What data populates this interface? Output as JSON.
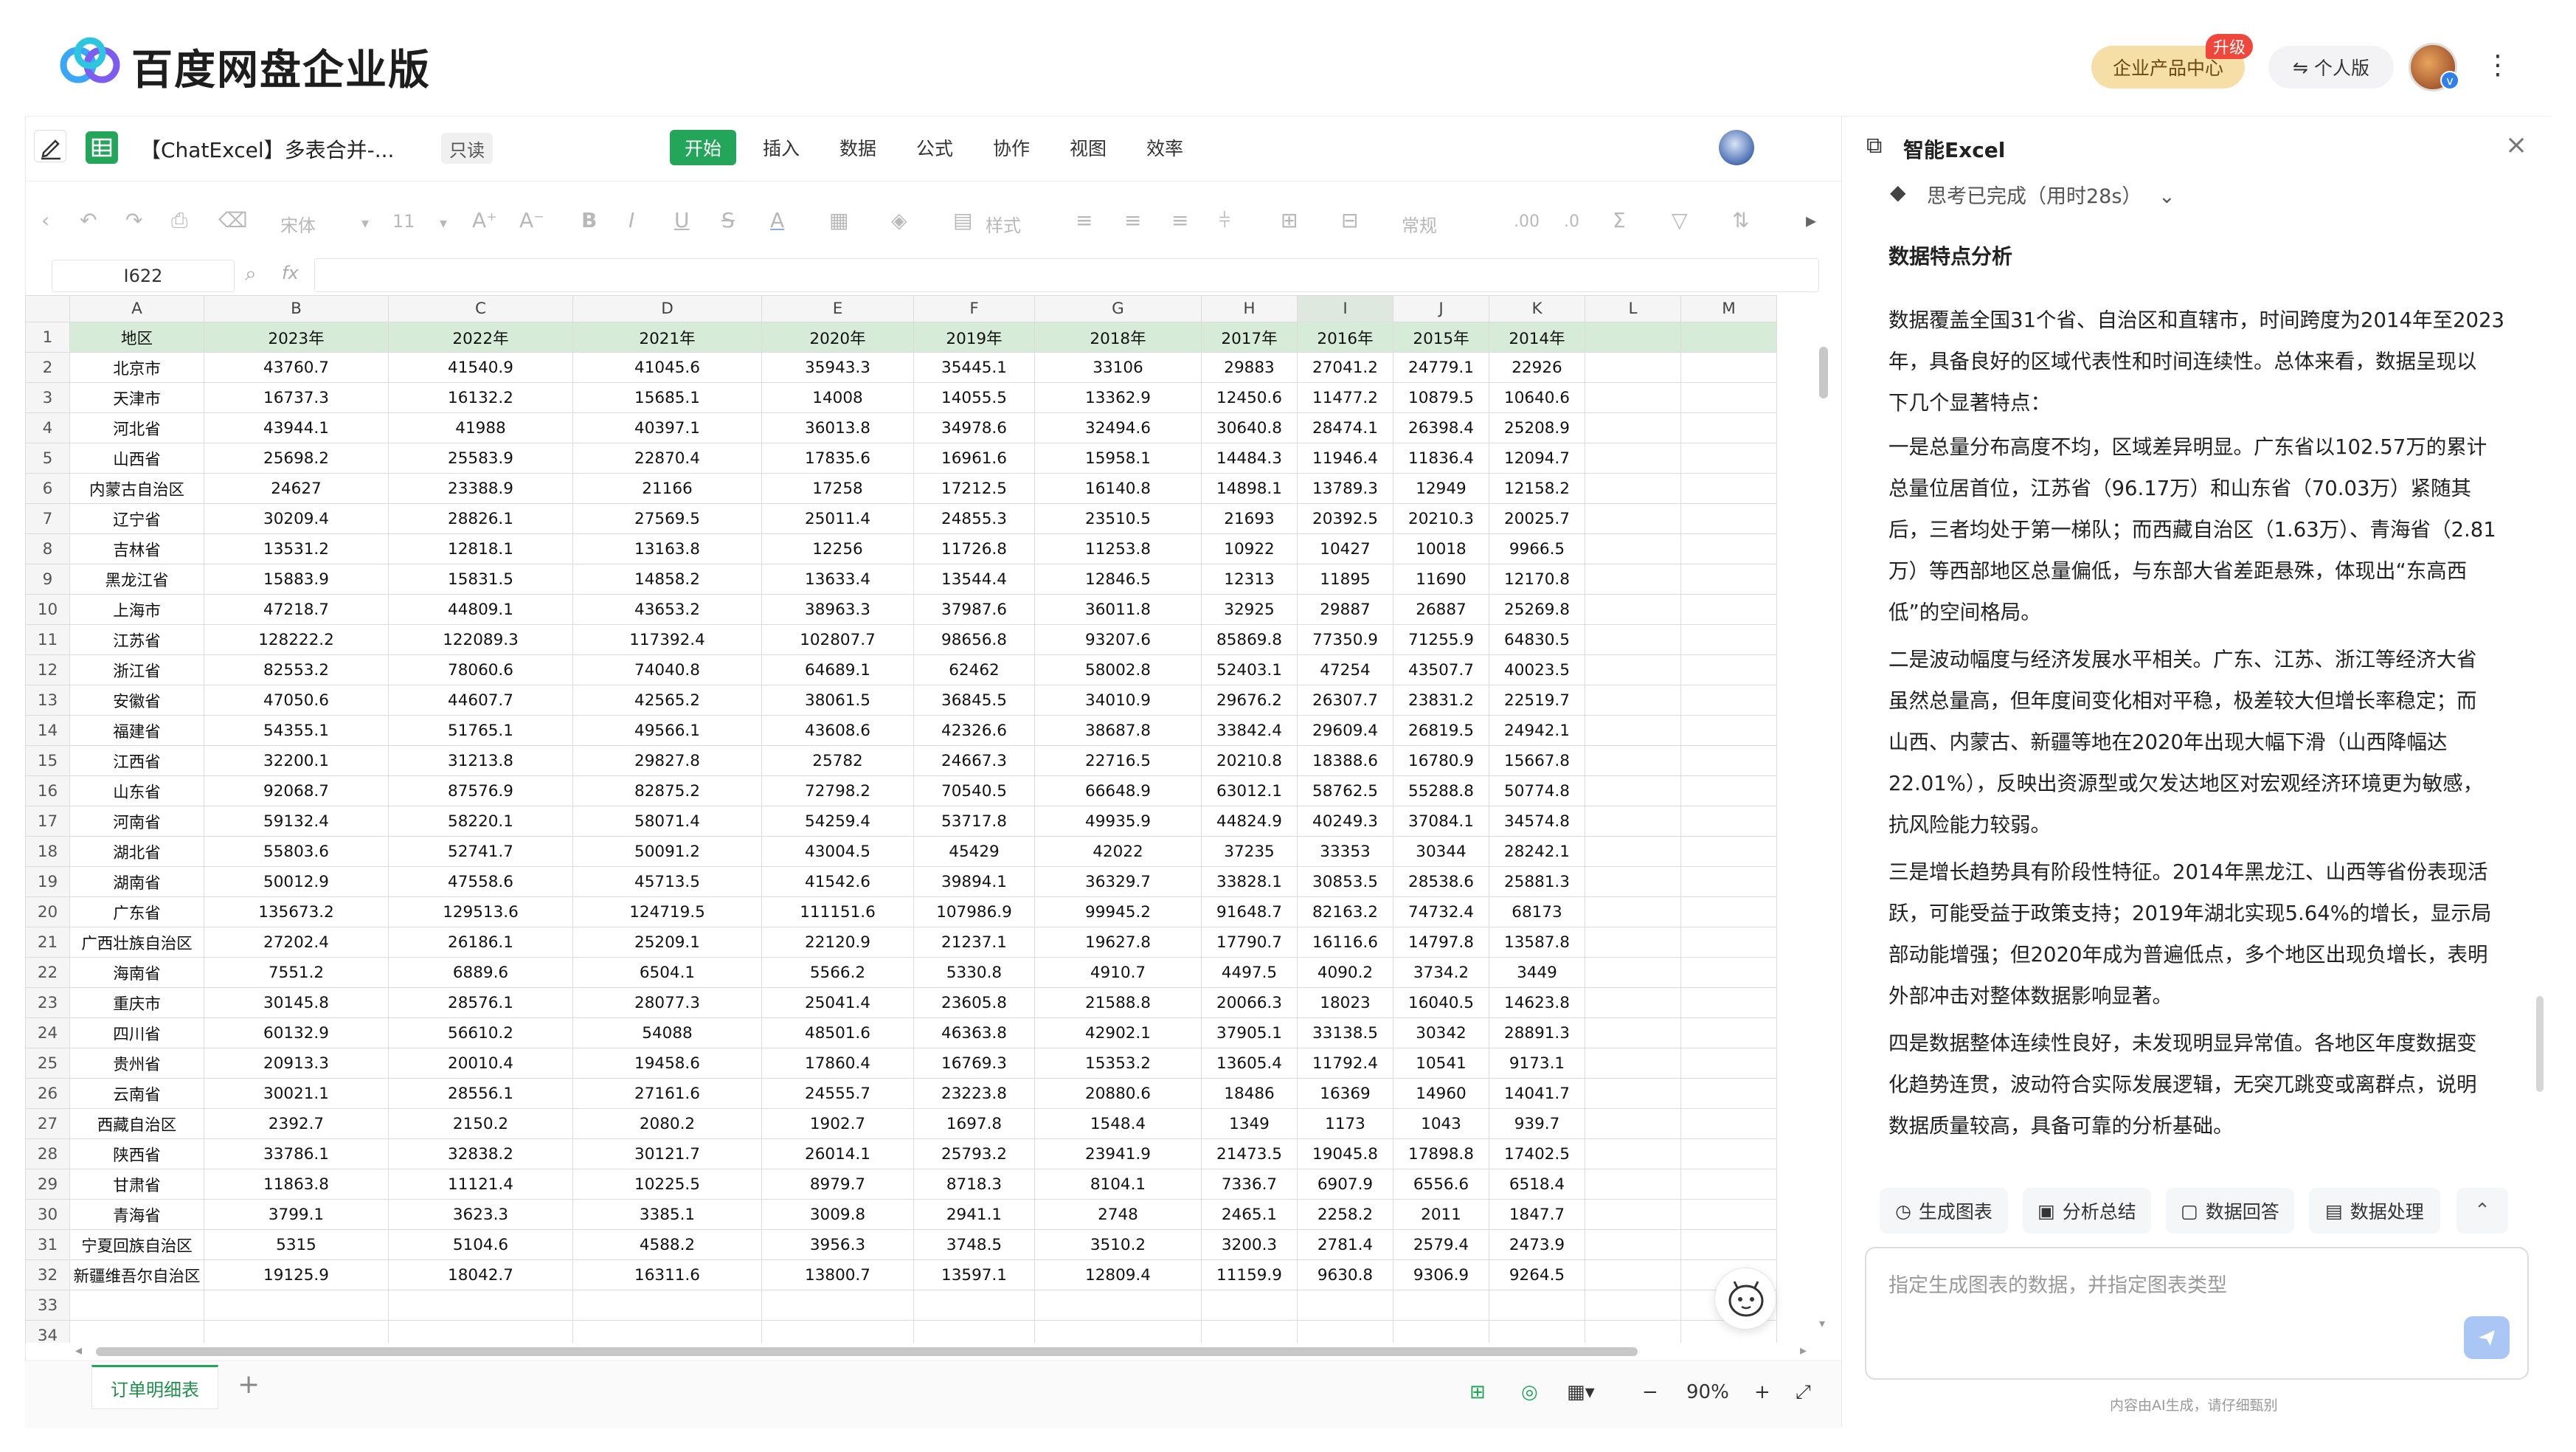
{
  "header": {
    "brand": "百度网盘企业版",
    "enterprise_center": "企业产品中心",
    "upgrade_badge": "升级",
    "personal": "个人版",
    "more": "⋮"
  },
  "doc": {
    "title": "【ChatExcel】多表合并-...",
    "readonly": "只读",
    "menus": [
      "开始",
      "插入",
      "数据",
      "公式",
      "协作",
      "视图",
      "效率"
    ]
  },
  "toolbar": {
    "font": "宋体",
    "size": "11",
    "style": "样式",
    "format": "常规"
  },
  "formula": {
    "cell_ref": "I622",
    "fx": "fx"
  },
  "sheet": {
    "col_letters": [
      "A",
      "B",
      "C",
      "D",
      "E",
      "F",
      "G",
      "H",
      "I",
      "J",
      "K",
      "L",
      "M"
    ],
    "headers": [
      "地区",
      "2023年",
      "2022年",
      "2021年",
      "2020年",
      "2019年",
      "2018年",
      "2017年",
      "2016年",
      "2015年",
      "2014年"
    ],
    "rows": [
      [
        "北京市",
        "43760.7",
        "41540.9",
        "41045.6",
        "35943.3",
        "35445.1",
        "33106",
        "29883",
        "27041.2",
        "24779.1",
        "22926"
      ],
      [
        "天津市",
        "16737.3",
        "16132.2",
        "15685.1",
        "14008",
        "14055.5",
        "13362.9",
        "12450.6",
        "11477.2",
        "10879.5",
        "10640.6"
      ],
      [
        "河北省",
        "43944.1",
        "41988",
        "40397.1",
        "36013.8",
        "34978.6",
        "32494.6",
        "30640.8",
        "28474.1",
        "26398.4",
        "25208.9"
      ],
      [
        "山西省",
        "25698.2",
        "25583.9",
        "22870.4",
        "17835.6",
        "16961.6",
        "15958.1",
        "14484.3",
        "11946.4",
        "11836.4",
        "12094.7"
      ],
      [
        "内蒙古自治区",
        "24627",
        "23388.9",
        "21166",
        "17258",
        "17212.5",
        "16140.8",
        "14898.1",
        "13789.3",
        "12949",
        "12158.2"
      ],
      [
        "辽宁省",
        "30209.4",
        "28826.1",
        "27569.5",
        "25011.4",
        "24855.3",
        "23510.5",
        "21693",
        "20392.5",
        "20210.3",
        "20025.7"
      ],
      [
        "吉林省",
        "13531.2",
        "12818.1",
        "13163.8",
        "12256",
        "11726.8",
        "11253.8",
        "10922",
        "10427",
        "10018",
        "9966.5"
      ],
      [
        "黑龙江省",
        "15883.9",
        "15831.5",
        "14858.2",
        "13633.4",
        "13544.4",
        "12846.5",
        "12313",
        "11895",
        "11690",
        "12170.8"
      ],
      [
        "上海市",
        "47218.7",
        "44809.1",
        "43653.2",
        "38963.3",
        "37987.6",
        "36011.8",
        "32925",
        "29887",
        "26887",
        "25269.8"
      ],
      [
        "江苏省",
        "128222.2",
        "122089.3",
        "117392.4",
        "102807.7",
        "98656.8",
        "93207.6",
        "85869.8",
        "77350.9",
        "71255.9",
        "64830.5"
      ],
      [
        "浙江省",
        "82553.2",
        "78060.6",
        "74040.8",
        "64689.1",
        "62462",
        "58002.8",
        "52403.1",
        "47254",
        "43507.7",
        "40023.5"
      ],
      [
        "安徽省",
        "47050.6",
        "44607.7",
        "42565.2",
        "38061.5",
        "36845.5",
        "34010.9",
        "29676.2",
        "26307.7",
        "23831.2",
        "22519.7"
      ],
      [
        "福建省",
        "54355.1",
        "51765.1",
        "49566.1",
        "43608.6",
        "42326.6",
        "38687.8",
        "33842.4",
        "29609.4",
        "26819.5",
        "24942.1"
      ],
      [
        "江西省",
        "32200.1",
        "31213.8",
        "29827.8",
        "25782",
        "24667.3",
        "22716.5",
        "20210.8",
        "18388.6",
        "16780.9",
        "15667.8"
      ],
      [
        "山东省",
        "92068.7",
        "87576.9",
        "82875.2",
        "72798.2",
        "70540.5",
        "66648.9",
        "63012.1",
        "58762.5",
        "55288.8",
        "50774.8"
      ],
      [
        "河南省",
        "59132.4",
        "58220.1",
        "58071.4",
        "54259.4",
        "53717.8",
        "49935.9",
        "44824.9",
        "40249.3",
        "37084.1",
        "34574.8"
      ],
      [
        "湖北省",
        "55803.6",
        "52741.7",
        "50091.2",
        "43004.5",
        "45429",
        "42022",
        "37235",
        "33353",
        "30344",
        "28242.1"
      ],
      [
        "湖南省",
        "50012.9",
        "47558.6",
        "45713.5",
        "41542.6",
        "39894.1",
        "36329.7",
        "33828.1",
        "30853.5",
        "28538.6",
        "25881.3"
      ],
      [
        "广东省",
        "135673.2",
        "129513.6",
        "124719.5",
        "111151.6",
        "107986.9",
        "99945.2",
        "91648.7",
        "82163.2",
        "74732.4",
        "68173"
      ],
      [
        "广西壮族自治区",
        "27202.4",
        "26186.1",
        "25209.1",
        "22120.9",
        "21237.1",
        "19627.8",
        "17790.7",
        "16116.6",
        "14797.8",
        "13587.8"
      ],
      [
        "海南省",
        "7551.2",
        "6889.6",
        "6504.1",
        "5566.2",
        "5330.8",
        "4910.7",
        "4497.5",
        "4090.2",
        "3734.2",
        "3449"
      ],
      [
        "重庆市",
        "30145.8",
        "28576.1",
        "28077.3",
        "25041.4",
        "23605.8",
        "21588.8",
        "20066.3",
        "18023",
        "16040.5",
        "14623.8"
      ],
      [
        "四川省",
        "60132.9",
        "56610.2",
        "54088",
        "48501.6",
        "46363.8",
        "42902.1",
        "37905.1",
        "33138.5",
        "30342",
        "28891.3"
      ],
      [
        "贵州省",
        "20913.3",
        "20010.4",
        "19458.6",
        "17860.4",
        "16769.3",
        "15353.2",
        "13605.4",
        "11792.4",
        "10541",
        "9173.1"
      ],
      [
        "云南省",
        "30021.1",
        "28556.1",
        "27161.6",
        "24555.7",
        "23223.8",
        "20880.6",
        "18486",
        "16369",
        "14960",
        "14041.7"
      ],
      [
        "西藏自治区",
        "2392.7",
        "2150.2",
        "2080.2",
        "1902.7",
        "1697.8",
        "1548.4",
        "1349",
        "1173",
        "1043",
        "939.7"
      ],
      [
        "陕西省",
        "33786.1",
        "32838.2",
        "30121.7",
        "26014.1",
        "25793.2",
        "23941.9",
        "21473.5",
        "19045.8",
        "17898.8",
        "17402.5"
      ],
      [
        "甘肃省",
        "11863.8",
        "11121.4",
        "10225.5",
        "8979.7",
        "8718.3",
        "8104.1",
        "7336.7",
        "6907.9",
        "6556.6",
        "6518.4"
      ],
      [
        "青海省",
        "3799.1",
        "3623.3",
        "3385.1",
        "3009.8",
        "2941.1",
        "2748",
        "2465.1",
        "2258.2",
        "2011",
        "1847.7"
      ],
      [
        "宁夏回族自治区",
        "5315",
        "5104.6",
        "4588.2",
        "3956.3",
        "3748.5",
        "3510.2",
        "3200.3",
        "2781.4",
        "2579.4",
        "2473.9"
      ],
      [
        "新疆维吾尔自治区",
        "19125.9",
        "18042.7",
        "16311.6",
        "13800.7",
        "13597.1",
        "12809.4",
        "11159.9",
        "9630.8",
        "9306.9",
        "9264.5"
      ]
    ],
    "tab": "订单明细表",
    "zoom": "90%"
  },
  "panel": {
    "title": "智能Excel",
    "thinking": "思考已完成（用时28s）",
    "section": "数据特点分析",
    "paragraphs": [
      [
        "数据覆盖全国31个省、自治区和直辖市，时间跨度为2014年至2023",
        "年，具备良好的区域代表性和时间连续性。总体来看，数据呈现以",
        "下几个显著特点："
      ],
      [
        "一是总量分布高度不均，区域差异明显。广东省以102.57万的累计",
        "总量位居首位，江苏省（96.17万）和山东省（70.03万）紧随其",
        "后，三者均处于第一梯队；而西藏自治区（1.63万）、青海省（2.81",
        "万）等西部地区总量偏低，与东部大省差距悬殊，体现出“东高西",
        "低”的空间格局。"
      ],
      [
        "二是波动幅度与经济发展水平相关。广东、江苏、浙江等经济大省",
        "虽然总量高，但年度间变化相对平稳，极差较大但增长率稳定；而",
        "山西、内蒙古、新疆等地在2020年出现大幅下滑（山西降幅达",
        "22.01%），反映出资源型或欠发达地区对宏观经济环境更为敏感，",
        "抗风险能力较弱。"
      ],
      [
        "三是增长趋势具有阶段性特征。2014年黑龙江、山西等省份表现活",
        "跃，可能受益于政策支持；2019年湖北实现5.64%的增长，显示局",
        "部动能增强；但2020年成为普遍低点，多个地区出现负增长，表明",
        "外部冲击对整体数据影响显著。"
      ],
      [
        "四是数据整体连续性良好，未发现明显异常值。各地区年度数据变",
        "化趋势连贯，波动符合实际发展逻辑，无突兀跳变或离群点，说明",
        "数据质量较高，具备可靠的分析基础。"
      ]
    ],
    "chips": [
      "生成图表",
      "分析总结",
      "数据回答",
      "数据处理"
    ],
    "input_placeholder": "指定生成图表的数据，并指定图表类型",
    "footer": "内容由AI生成，请仔细甄别"
  },
  "colors": {
    "accent_green": "#23a55a",
    "header_row_bg": "#d6ecd9",
    "enterprise_pill": "#f6dfa7",
    "send_button": "#a9c6f5"
  }
}
